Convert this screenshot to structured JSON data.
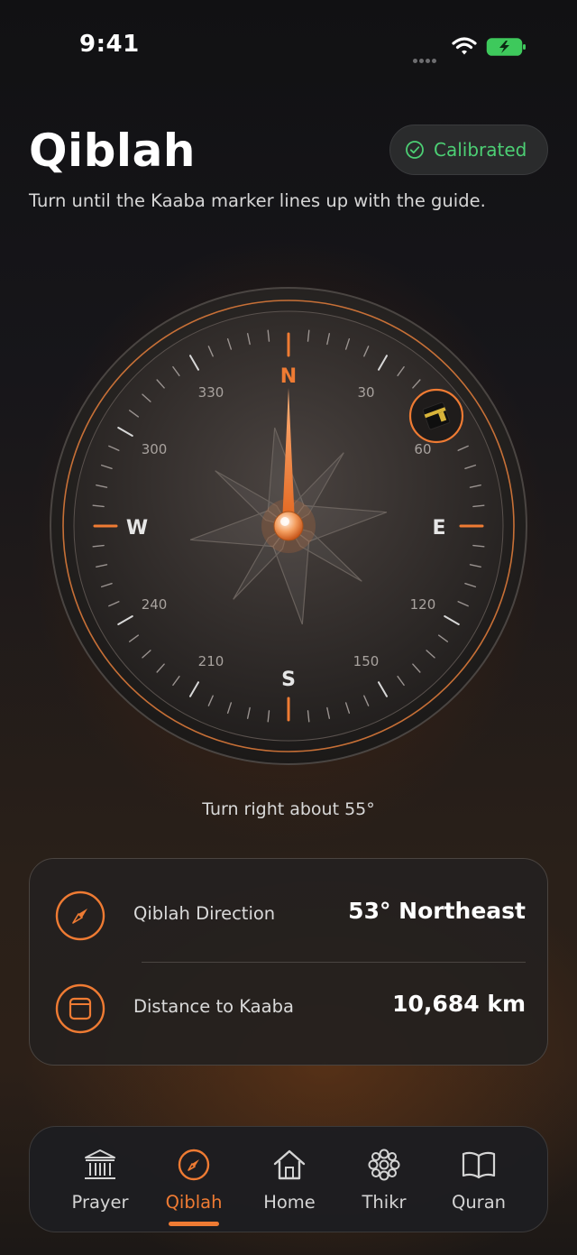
{
  "status_bar": {
    "time": "9:41"
  },
  "header": {
    "title": "Qiblah",
    "badge_label": "Calibrated",
    "subtitle": "Turn until the Kaaba marker lines up with the guide."
  },
  "compass": {
    "cardinals": {
      "n": "N",
      "e": "E",
      "s": "S",
      "w": "W"
    },
    "degree_labels": [
      "30",
      "60",
      "120",
      "150",
      "210",
      "240",
      "300",
      "330"
    ],
    "qiblah_bearing_deg": 53,
    "kaaba_marker_icon": "kaaba-icon"
  },
  "hint": "Turn right about 55°",
  "info": {
    "direction_label": "Qiblah Direction",
    "direction_value": "53° Northeast",
    "direction_icon": "compass-icon",
    "distance_label": "Distance to Kaaba",
    "distance_value": "10,684 km",
    "distance_icon": "kaaba-outline-icon"
  },
  "nav": {
    "items": [
      {
        "label": "Prayer",
        "icon": "mosque-icon"
      },
      {
        "label": "Qiblah",
        "icon": "compass-icon"
      },
      {
        "label": "Home",
        "icon": "home-icon"
      },
      {
        "label": "Thikr",
        "icon": "beads-icon"
      },
      {
        "label": "Quran",
        "icon": "book-icon"
      }
    ],
    "active_index": 1
  },
  "colors": {
    "accent": "#ef7b33",
    "success": "#4ccf74",
    "background": "#141416"
  }
}
